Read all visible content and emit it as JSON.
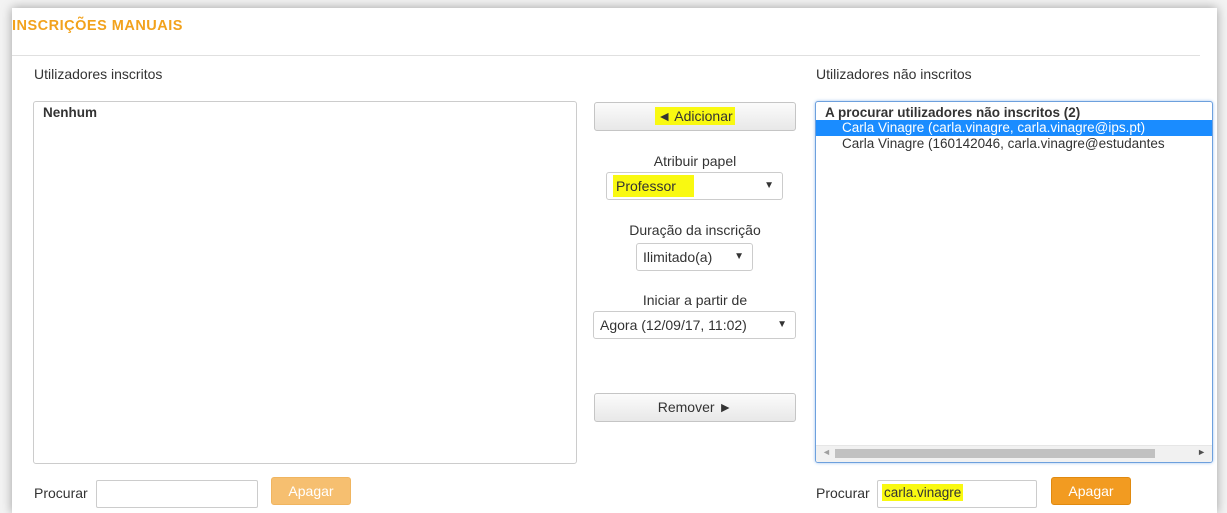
{
  "title": "INSCRIÇÕES MANUAIS",
  "enrolled": {
    "label": "Utilizadores inscritos",
    "list_heading": "Nenhum",
    "search_label": "Procurar",
    "search_value": "",
    "clear_label": "Apagar"
  },
  "middle": {
    "add_label": "◄ Adicionar",
    "role_label": "Atribuir papel",
    "role_value": "Professor",
    "duration_label": "Duração da inscrição",
    "duration_value": "Ilimitado(a)",
    "start_label": "Iniciar a partir de",
    "start_value": "Agora (12/09/17, 11:02)",
    "remove_label": "Remover ►"
  },
  "not_enrolled": {
    "label": "Utilizadores não inscritos",
    "list_heading": "A procurar utilizadores não inscritos (2)",
    "options": [
      "Carla Vinagre (carla.vinagre, carla.vinagre@ips.pt)",
      "Carla Vinagre (160142046, carla.vinagre@estudantes"
    ],
    "search_label": "Procurar",
    "search_value": "carla.vinagre",
    "clear_label": "Apagar"
  },
  "colors": {
    "accent": "#f2a21c",
    "selection": "#1a8cff",
    "highlight": "#f9f911",
    "button_orange": "#f29b21",
    "button_orange_disabled": "#f6bf70"
  }
}
